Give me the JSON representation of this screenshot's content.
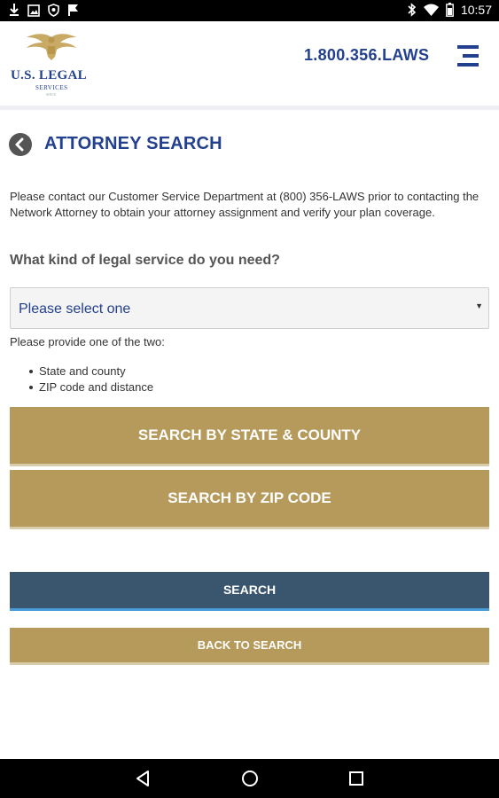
{
  "status_bar": {
    "time": "10:57",
    "left_icons": [
      "download-icon",
      "image-icon",
      "vpn-icon",
      "flag-icon"
    ],
    "right_icons": [
      "bluetooth-icon",
      "wifi-icon",
      "battery-icon"
    ]
  },
  "header": {
    "logo_text": "U.S. LEGAL",
    "logo_sub": "SERVICES",
    "logo_sub2": "SINCE",
    "phone": "1.800.356.LAWS",
    "menu_icon": "menu-icon"
  },
  "page": {
    "title": "ATTORNEY SEARCH",
    "intro": "Please contact our Customer Service Department at (800) 356-LAWS prior to contacting the Network Attorney to obtain your attorney assignment and verify your plan coverage.",
    "question": "What kind of legal service do you need?",
    "select": {
      "value": "Please select one"
    },
    "provide": "Please provide one of the two:",
    "bullets": [
      "State and county",
      "ZIP code and distance"
    ],
    "buttons": {
      "state_county": "SEARCH BY STATE & COUNTY",
      "zip_code": "SEARCH BY ZIP CODE",
      "search": "SEARCH",
      "back_to_search": "BACK TO SEARCH"
    }
  },
  "nav_bar": {
    "icons": [
      "back-triangle-icon",
      "home-circle-icon",
      "recents-square-icon"
    ]
  },
  "colors": {
    "brand_blue": "#23408e",
    "gold": "#b59a5b",
    "search_blue": "#3a566f",
    "search_accent": "#4a9cd8"
  }
}
